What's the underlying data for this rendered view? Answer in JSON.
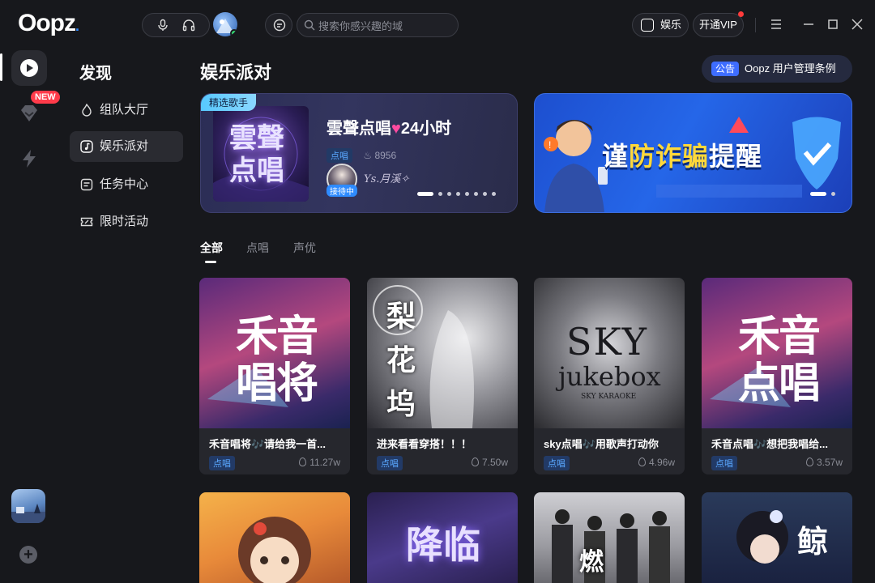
{
  "topbar": {
    "logo": "Oopz",
    "search_placeholder": "搜索你感兴趣的域",
    "entertainment_label": "娱乐",
    "vip_label": "开通VIP"
  },
  "rail": {
    "new_badge": "NEW"
  },
  "sidebar": {
    "title": "发现",
    "items": [
      {
        "label": "组队大厅"
      },
      {
        "label": "娱乐派对"
      },
      {
        "label": "任务中心"
      },
      {
        "label": "限时活动"
      }
    ]
  },
  "main": {
    "title": "娱乐派对",
    "notice_tag": "公告",
    "notice_text": "Oopz 用户管理条例"
  },
  "featured": {
    "tag": "精选歌手",
    "cover_text": "雲聲点唱",
    "title_prefix": "雲聲点唱",
    "title_suffix": "24小时",
    "chip": "点唱",
    "count": "8956",
    "host_tag": "接待中",
    "host_name": "Ys.月溪✧"
  },
  "promo": {
    "text_a": "谨",
    "text_b": "防诈骗",
    "text_c": "提醒"
  },
  "tabs": [
    {
      "label": "全部"
    },
    {
      "label": "点唱"
    },
    {
      "label": "声优"
    }
  ],
  "cards": [
    {
      "title": "禾音唱将🎶请给我一首...",
      "tag": "点唱",
      "count": "11.27w",
      "art": "禾音唱将"
    },
    {
      "title": "进来看看穿搭！！！",
      "tag": "点唱",
      "count": "7.50w",
      "art": "梨花坞"
    },
    {
      "title": "sky点唱🎶用歌声打动你",
      "tag": "点唱",
      "count": "4.96w",
      "art_a": "SKY",
      "art_b": "jukebox",
      "art_c": "SKY KARAOKE"
    },
    {
      "title": "禾音点唱🎶想把我唱给...",
      "tag": "点唱",
      "count": "3.57w",
      "art": "禾音点唱"
    }
  ],
  "cards_row2": [
    {
      "art": ""
    },
    {
      "art": "降临"
    },
    {
      "art": "燃"
    },
    {
      "art": "鲸"
    }
  ],
  "colors": {
    "background": "#17181c",
    "accent": "#2e87ff",
    "chip_text": "#5aa7ff"
  }
}
